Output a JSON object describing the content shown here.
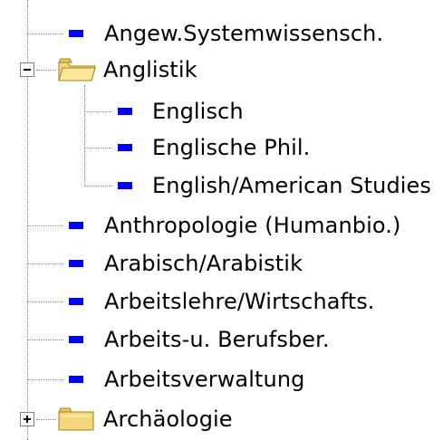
{
  "tree": {
    "items": [
      {
        "label": "Angew.Systemwissensch.",
        "type": "leaf",
        "level": 0
      },
      {
        "label": "Anglistik",
        "type": "folder",
        "expanded": true,
        "level": 0
      },
      {
        "label": "Englisch",
        "type": "leaf",
        "level": 1
      },
      {
        "label": "Englische Phil.",
        "type": "leaf",
        "level": 1
      },
      {
        "label": "English/American Studies",
        "type": "leaf",
        "level": 1
      },
      {
        "label": "Anthropologie (Humanbio.)",
        "type": "leaf",
        "level": 0
      },
      {
        "label": "Arabisch/Arabistik",
        "type": "leaf",
        "level": 0
      },
      {
        "label": "Arbeitslehre/Wirtschafts.",
        "type": "leaf",
        "level": 0
      },
      {
        "label": "Arbeits-u. Berufsber.",
        "type": "leaf",
        "level": 0
      },
      {
        "label": "Arbeitsverwaltung",
        "type": "leaf",
        "level": 0
      },
      {
        "label": "Archäologie",
        "type": "folder",
        "expanded": false,
        "level": 0
      }
    ]
  },
  "colors": {
    "leaf_icon": "#0000ff",
    "folder": "#f4d77a",
    "connector": "#808080"
  },
  "icons": {
    "leaf": "blue-square-icon",
    "folder": "folder-icon",
    "expanded": "minus-box-icon",
    "collapsed": "plus-box-icon"
  }
}
